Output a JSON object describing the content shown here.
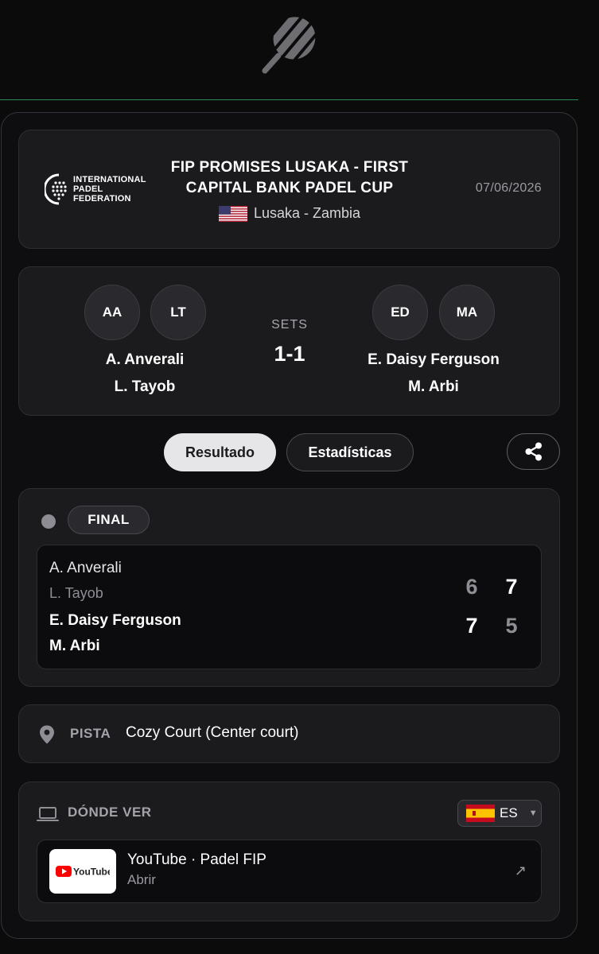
{
  "tournament": {
    "org_lines": [
      "INTERNATIONAL",
      "PADEL",
      "FEDERATION"
    ],
    "name_line1": "FIP PROMISES LUSAKA - FIRST",
    "name_line2": "CAPITAL BANK PADEL CUP",
    "location": "Lusaka - Zambia",
    "date": "07/06/2026"
  },
  "match": {
    "team1": {
      "initials": [
        "AA",
        "LT"
      ],
      "players": [
        "A. Anverali",
        "L. Tayob"
      ]
    },
    "team2": {
      "initials": [
        "ED",
        "MA"
      ],
      "players": [
        "E. Daisy Ferguson",
        "M. Arbi"
      ]
    },
    "sets_label": "SETS",
    "sets_score": "1-1"
  },
  "tabs": {
    "result": "Resultado",
    "stats": "Estadísticas"
  },
  "result": {
    "status": "FINAL",
    "team1_players": [
      "A. Anverali",
      "L. Tayob"
    ],
    "team2_players": [
      "E. Daisy Ferguson",
      "M. Arbi"
    ],
    "team1_games": [
      "6",
      "7"
    ],
    "team2_games": [
      "7",
      "5"
    ]
  },
  "court": {
    "label": "PISTA",
    "value": "Cozy Court (Center court)"
  },
  "watch": {
    "label": "DÓNDE VER",
    "language": "ES",
    "stream_brand": "YouTube",
    "stream_title": "YouTube · Padel FIP",
    "stream_action": "Abrir"
  },
  "colors": {
    "accent_line": "#2f8a5a",
    "card_bg": "#1b1b1e",
    "youtube_red": "#ff0000"
  }
}
